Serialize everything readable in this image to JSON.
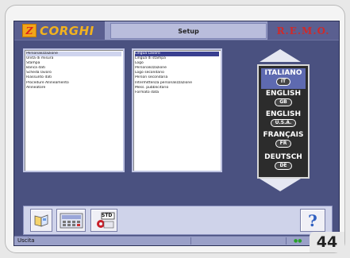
{
  "header": {
    "brand_left": "CORGHI",
    "brand_left_mark": "Z",
    "title": "Setup",
    "brand_right": "R.E.M.O."
  },
  "left_list": {
    "items": [
      "Personalizzazione",
      "Unità di misura",
      "Stampa",
      "Banca dati",
      "Scheda lavoro",
      "Riassunto dati",
      "Procedure Allineamento",
      "Allineatore"
    ],
    "selected_index": 0
  },
  "middle_list": {
    "items": [
      "Lingua Lavoro",
      "Lingua di stampa",
      "Logo",
      "Personalizzazione",
      "Logo secondario",
      "Person secondaria",
      "Intermittenza personalizzazione",
      "Mess. pubblicitario",
      "Formato data"
    ],
    "highlighted_index": 0
  },
  "languages": [
    {
      "name": "ITALIANO",
      "code": "IT"
    },
    {
      "name": "ENGLISH",
      "code": "GB"
    },
    {
      "name": "ENGLISH",
      "code": "U.S.A."
    },
    {
      "name": "FRANÇAIS",
      "code": "FR"
    },
    {
      "name": "DEUTSCH",
      "code": "DE"
    }
  ],
  "toolbar": {
    "std_label": "STD",
    "help_label": "?"
  },
  "status": {
    "left_text": "Uscita",
    "right_text": "●●"
  },
  "page_number": "44",
  "colors": {
    "screen_bg": "#4a5180",
    "accent": "#5e6ab0",
    "brand_orange": "#f2b21e",
    "brand_red": "#cf2a2a"
  }
}
